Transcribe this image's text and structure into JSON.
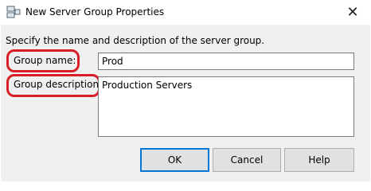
{
  "window": {
    "title": "New Server Group Properties",
    "icon": "server-group-icon",
    "close_glyph": "✕"
  },
  "form": {
    "instructions": "Specify the name and description of the server group.",
    "group_name_label": "Group name:",
    "group_name_value": "Prod",
    "group_description_label": "Group description:",
    "group_description_value": "Production Servers"
  },
  "buttons": {
    "ok": "OK",
    "cancel": "Cancel",
    "help": "Help"
  },
  "colors": {
    "highlight_ring": "#d81f26",
    "default_button_border": "#0078d7",
    "dialog_background": "#f0f0f0"
  }
}
